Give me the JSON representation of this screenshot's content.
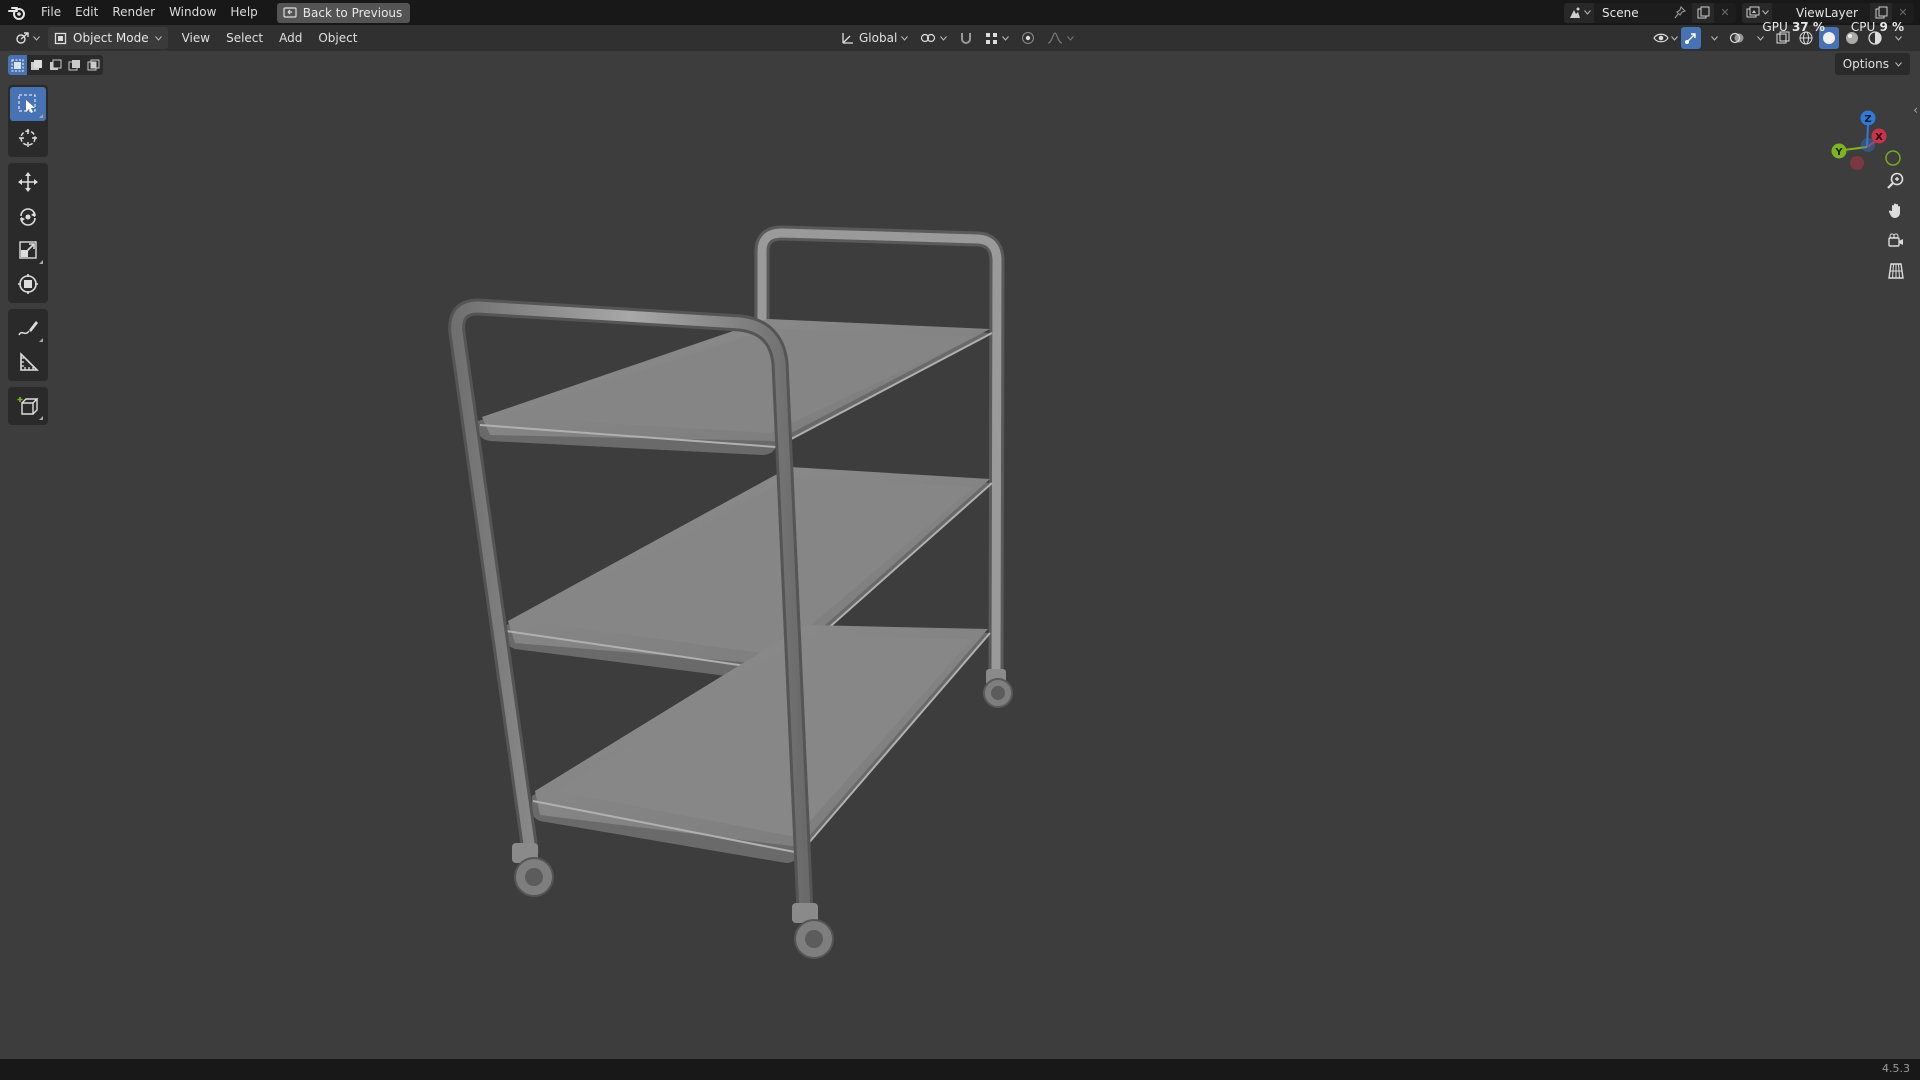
{
  "topbar": {
    "menus": [
      "File",
      "Edit",
      "Render",
      "Window",
      "Help"
    ],
    "back_button": "Back to Previous",
    "scene_name": "Scene",
    "view_layer": "ViewLayer",
    "gpu_label": "GPU",
    "gpu_value": "37 %",
    "cpu_label": "CPU",
    "cpu_value": "9 %"
  },
  "header": {
    "mode": "Object Mode",
    "menus": [
      "View",
      "Select",
      "Add",
      "Object"
    ],
    "transform_orientation": "Global"
  },
  "viewport": {
    "options_label": "Options",
    "gizmo_axes": [
      "Z",
      "X",
      "Y"
    ],
    "colors": {
      "x": "#c8334a",
      "y": "#7fb321",
      "z": "#2f7ad8",
      "active": "#4772b3"
    }
  },
  "statusbar": {
    "version": "4.5.3"
  }
}
